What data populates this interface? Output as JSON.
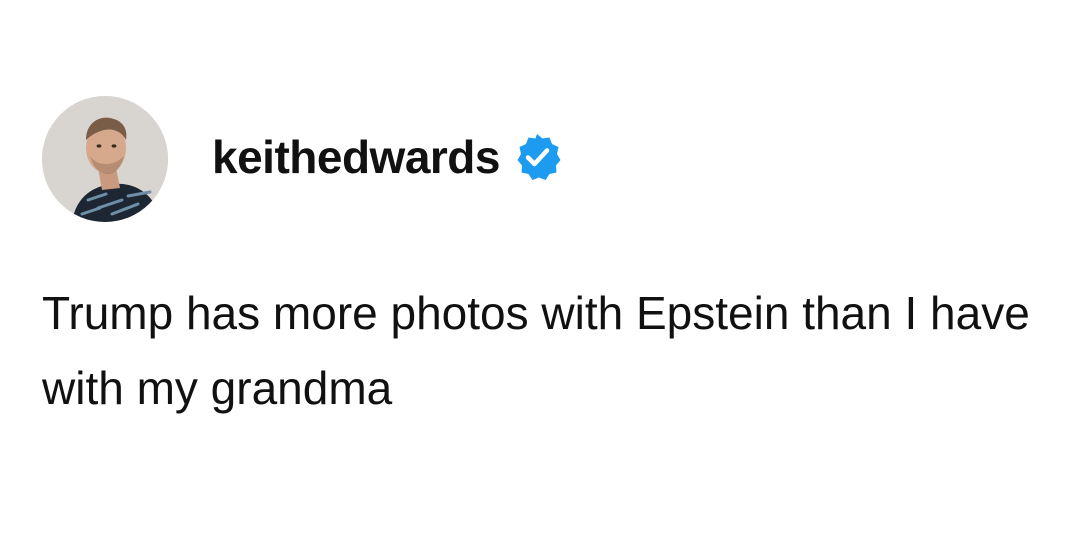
{
  "post": {
    "username": "keithedwards",
    "verified": true,
    "text": "Trump has more photos with Epstein than I have with my grandma"
  },
  "icons": {
    "avatar": "profile-photo",
    "badge": "verified-badge-icon"
  },
  "colors": {
    "background": "#ffffff",
    "text": "#111111",
    "verified_badge": "#1d9bf0"
  }
}
